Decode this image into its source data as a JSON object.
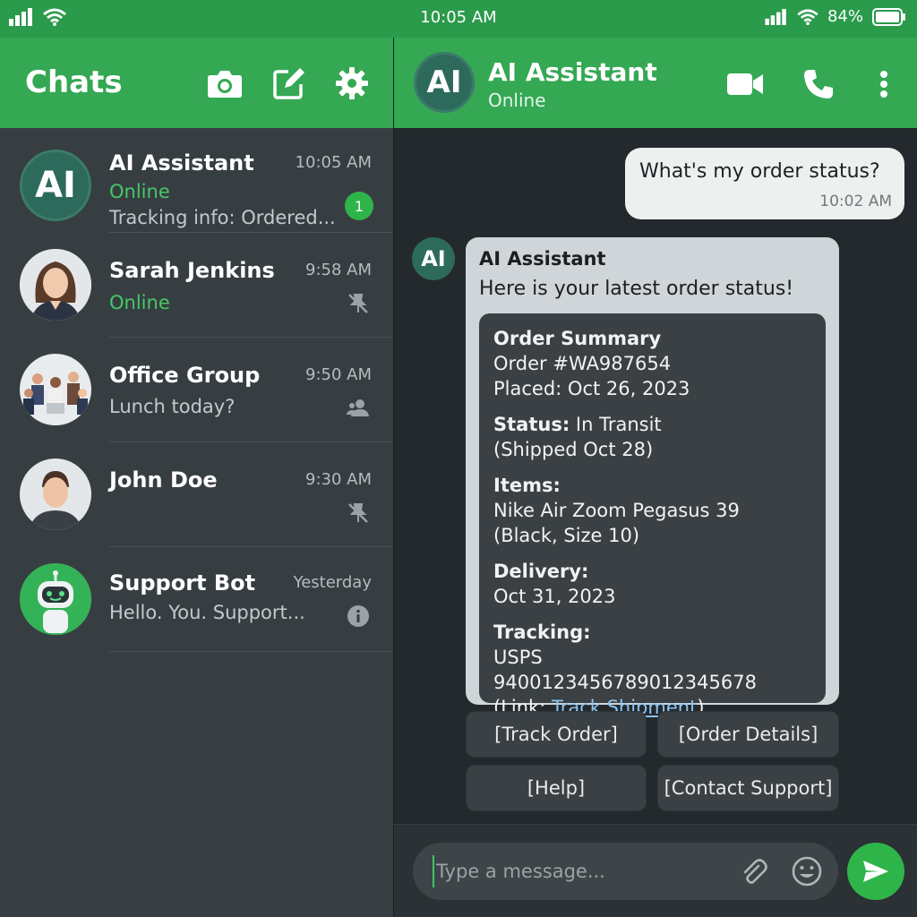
{
  "status_bar": {
    "time": "10:05 AM",
    "battery": "84%"
  },
  "sidebar": {
    "title": "Chats",
    "chats": [
      {
        "name": "AI Assistant",
        "time": "10:05 AM",
        "status": "Online",
        "preview": "Tracking info: Ordered...",
        "unread": "1",
        "avatar_text": "AI"
      },
      {
        "name": "Sarah Jenkins",
        "time": "9:58 AM",
        "status": "Online"
      },
      {
        "name": "Office Group",
        "time": "9:50 AM",
        "preview": "Lunch today?"
      },
      {
        "name": "John Doe",
        "time": "9:30 AM"
      },
      {
        "name": "Support Bot",
        "time": "Yesterday",
        "preview": "Hello. You. Support..."
      }
    ]
  },
  "conversation": {
    "header": {
      "avatar_text": "AI",
      "name": "AI Assistant",
      "status": "Online"
    },
    "outgoing": {
      "text": "What's my order status?",
      "time": "10:02 AM"
    },
    "incoming": {
      "avatar_text": "AI",
      "sender": "AI Assistant",
      "text": "Here is your latest order status!",
      "card": {
        "summary_title": "Order Summary",
        "order_number": "Order #WA987654",
        "placed": "Placed: Oct 26, 2023",
        "status_label": "Status:",
        "status_value": " In Transit",
        "shipped": "(Shipped Oct 28)",
        "items_label": "Items:",
        "item_name": "Nike Air Zoom Pegasus 39",
        "item_detail": "(Black, Size 10)",
        "delivery_label": "Delivery:",
        "delivery_date": "Oct 31, 2023",
        "tracking_label": "Tracking:",
        "tracking_number": "USPS 9400123456789012345678",
        "link_prefix": "(Link: ",
        "link_text": "Track Shipment",
        "link_suffix": ")"
      }
    },
    "quick_replies": [
      "[Track Order]",
      "[Order Details]",
      "[Help]",
      "[Contact Support]"
    ],
    "composer": {
      "placeholder": "Type a message..."
    }
  },
  "colors": {
    "brand_green": "#34a853",
    "online_green": "#45c866",
    "link_blue": "#8ec3f0"
  }
}
